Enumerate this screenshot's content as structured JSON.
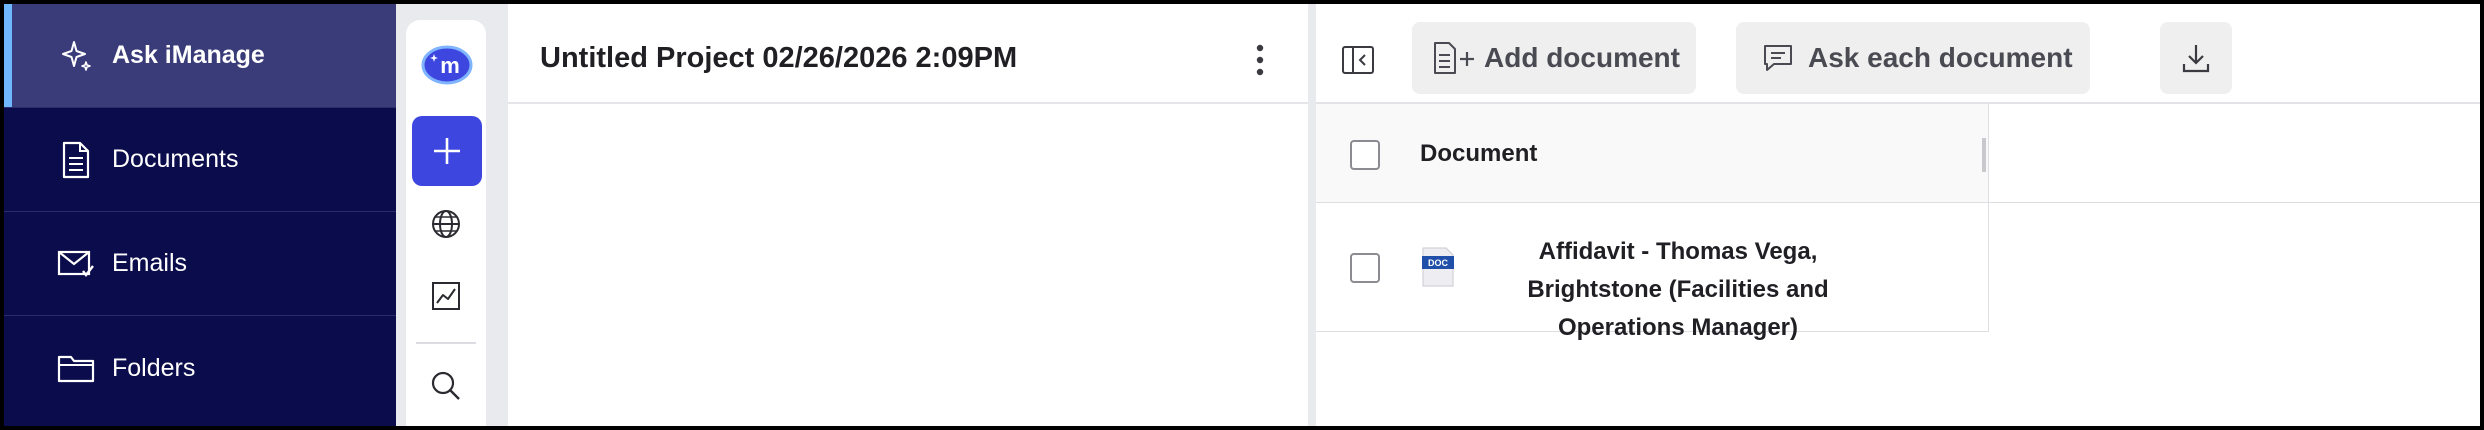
{
  "nav": {
    "items": [
      {
        "label": "Ask iManage",
        "icon": "sparkle-icon",
        "active": true
      },
      {
        "label": "Documents",
        "icon": "document-icon",
        "active": false
      },
      {
        "label": "Emails",
        "icon": "email-icon",
        "active": false
      },
      {
        "label": "Folders",
        "icon": "folder-icon",
        "active": false
      }
    ]
  },
  "rail": {
    "logo_text": "m",
    "icons": [
      "new-plus-icon",
      "globe-icon",
      "chart-icon",
      "search-icon"
    ]
  },
  "project": {
    "title": "Untitled Project 02/26/2026 2:09PM"
  },
  "toolbar": {
    "add_document_label": "Add document",
    "ask_each_label": "Ask each document"
  },
  "table": {
    "columns": [
      "Document"
    ],
    "rows": [
      {
        "doc_type_badge": "DOC",
        "name": "Affidavit - Thomas Vega, Brightstone (Facilities and Operations Manager)"
      }
    ]
  },
  "colors": {
    "nav_bg": "#0b0c4b",
    "nav_active": "#3a3c79",
    "accent": "#3e46e0",
    "active_indicator": "#6fb7ff"
  }
}
